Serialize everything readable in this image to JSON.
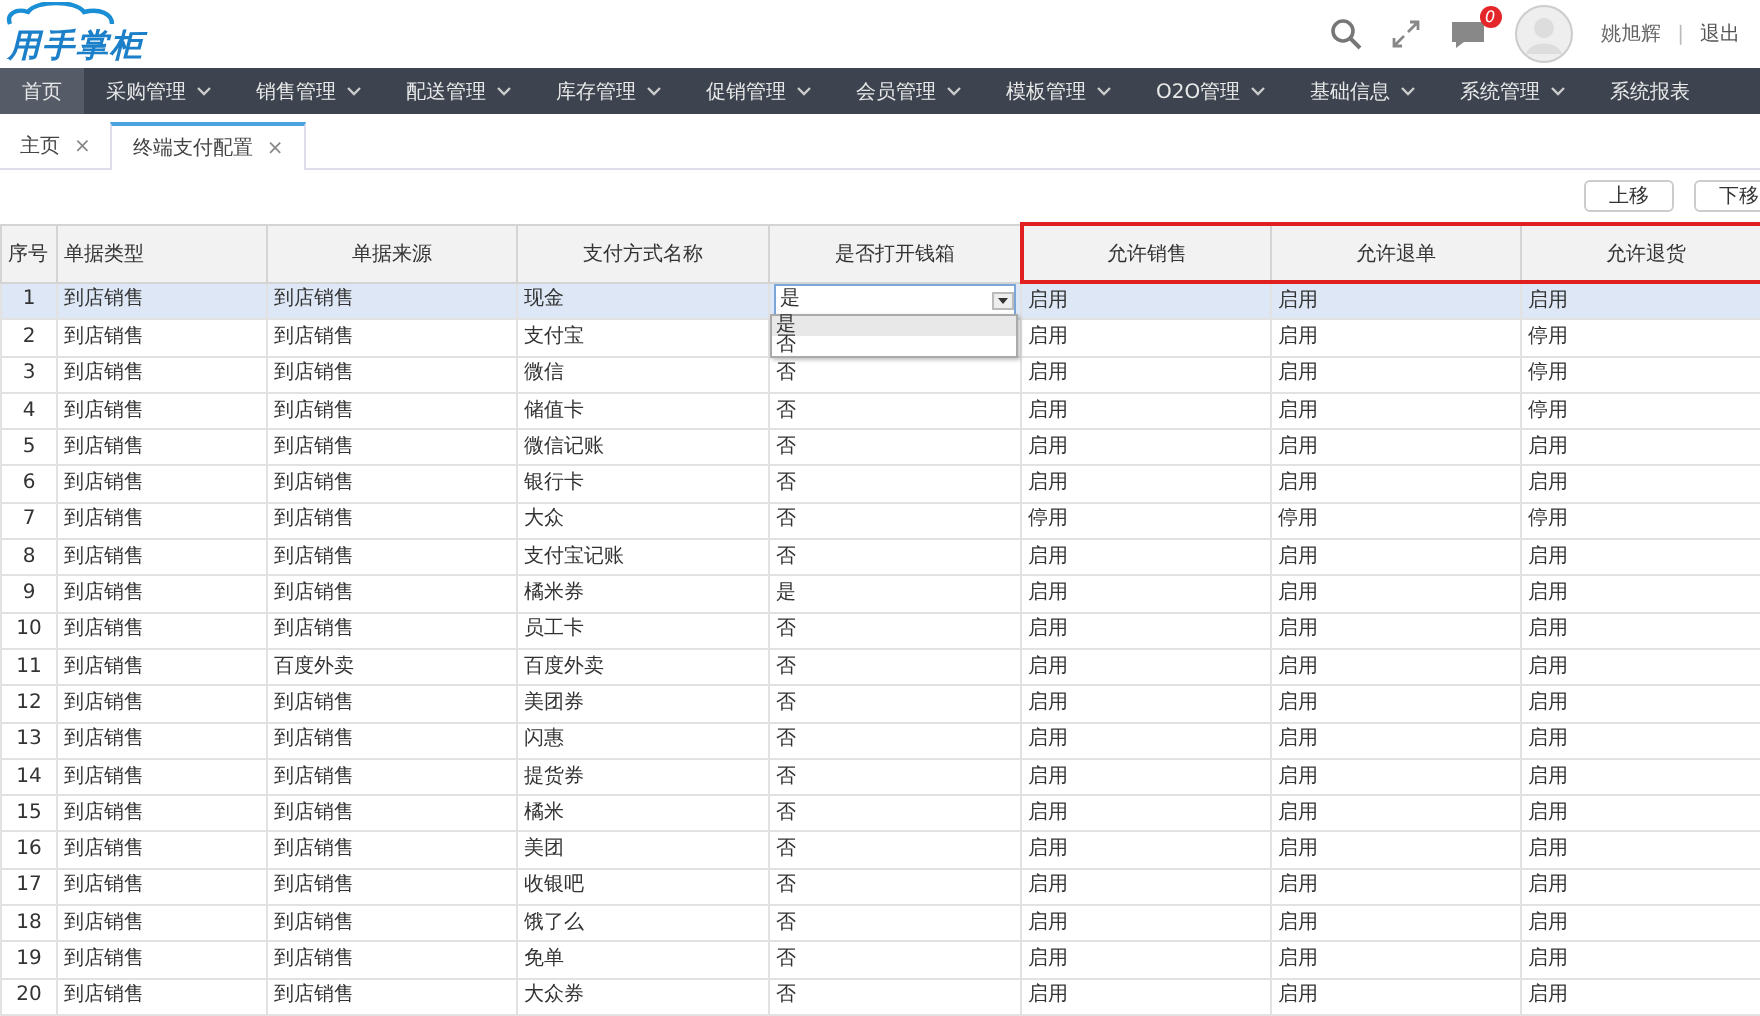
{
  "header": {
    "logo": "用手掌柜",
    "notification_count": "0",
    "user_name": "姚旭辉",
    "separator": "|",
    "logout": "退出"
  },
  "nav": [
    {
      "label": "首页",
      "selected": true,
      "dropdown": false
    },
    {
      "label": "采购管理",
      "selected": false,
      "dropdown": true
    },
    {
      "label": "销售管理",
      "selected": false,
      "dropdown": true
    },
    {
      "label": "配送管理",
      "selected": false,
      "dropdown": true
    },
    {
      "label": "库存管理",
      "selected": false,
      "dropdown": true
    },
    {
      "label": "促销管理",
      "selected": false,
      "dropdown": true
    },
    {
      "label": "会员管理",
      "selected": false,
      "dropdown": true
    },
    {
      "label": "模板管理",
      "selected": false,
      "dropdown": true
    },
    {
      "label": "O2O管理",
      "selected": false,
      "dropdown": true
    },
    {
      "label": "基础信息",
      "selected": false,
      "dropdown": true
    },
    {
      "label": "系统管理",
      "selected": false,
      "dropdown": true
    },
    {
      "label": "系统报表",
      "selected": false,
      "dropdown": false
    }
  ],
  "tabs": [
    {
      "label": "主页",
      "close": "×",
      "selected": false
    },
    {
      "label": "终端支付配置",
      "close": "×",
      "selected": true
    }
  ],
  "toolbar": {
    "buttons": [
      "上移",
      "下移"
    ]
  },
  "table": {
    "columns": [
      {
        "label": "序号",
        "highlighted": false
      },
      {
        "label": "单据类型",
        "highlighted": false
      },
      {
        "label": "单据来源",
        "highlighted": false
      },
      {
        "label": "支付方式名称",
        "highlighted": false
      },
      {
        "label": "是否打开钱箱",
        "highlighted": false
      },
      {
        "label": "允许销售",
        "highlighted": true
      },
      {
        "label": "允许退单",
        "highlighted": true
      },
      {
        "label": "允许退货",
        "highlighted": true
      }
    ],
    "rows": [
      {
        "no": "1",
        "type": "到店销售",
        "source": "到店销售",
        "payment": "现金",
        "cashbox": "是",
        "sale": "启用",
        "refund": "启用",
        "return_goods": "启用",
        "selected": true,
        "editing": true
      },
      {
        "no": "2",
        "type": "到店销售",
        "source": "到店销售",
        "payment": "支付宝",
        "sale": "启用",
        "refund": "启用",
        "return_goods": "停用",
        "selected": false,
        "editing": false
      },
      {
        "no": "3",
        "type": "到店销售",
        "source": "到店销售",
        "payment": "微信",
        "cashbox": "否",
        "sale": "启用",
        "refund": "启用",
        "return_goods": "停用",
        "selected": false,
        "editing": false
      },
      {
        "no": "4",
        "type": "到店销售",
        "source": "到店销售",
        "payment": "储值卡",
        "cashbox": "否",
        "sale": "启用",
        "refund": "启用",
        "return_goods": "停用",
        "selected": false,
        "editing": false
      },
      {
        "no": "5",
        "type": "到店销售",
        "source": "到店销售",
        "payment": "微信记账",
        "cashbox": "否",
        "sale": "启用",
        "refund": "启用",
        "return_goods": "启用",
        "selected": false,
        "editing": false
      },
      {
        "no": "6",
        "type": "到店销售",
        "source": "到店销售",
        "payment": "银行卡",
        "cashbox": "否",
        "sale": "启用",
        "refund": "启用",
        "return_goods": "启用",
        "selected": false,
        "editing": false
      },
      {
        "no": "7",
        "type": "到店销售",
        "source": "到店销售",
        "payment": "大众",
        "cashbox": "否",
        "sale": "停用",
        "refund": "停用",
        "return_goods": "停用",
        "selected": false,
        "editing": false
      },
      {
        "no": "8",
        "type": "到店销售",
        "source": "到店销售",
        "payment": "支付宝记账",
        "cashbox": "否",
        "sale": "启用",
        "refund": "启用",
        "return_goods": "启用",
        "selected": false,
        "editing": false
      },
      {
        "no": "9",
        "type": "到店销售",
        "source": "到店销售",
        "payment": "橘米券",
        "cashbox": "是",
        "sale": "启用",
        "refund": "启用",
        "return_goods": "启用",
        "selected": false,
        "editing": false
      },
      {
        "no": "10",
        "type": "到店销售",
        "source": "到店销售",
        "payment": "员工卡",
        "cashbox": "否",
        "sale": "启用",
        "refund": "启用",
        "return_goods": "启用",
        "selected": false,
        "editing": false
      },
      {
        "no": "11",
        "type": "到店销售",
        "source": "百度外卖",
        "payment": "百度外卖",
        "cashbox": "否",
        "sale": "启用",
        "refund": "启用",
        "return_goods": "启用",
        "selected": false,
        "editing": false
      },
      {
        "no": "12",
        "type": "到店销售",
        "source": "到店销售",
        "payment": "美团券",
        "cashbox": "否",
        "sale": "启用",
        "refund": "启用",
        "return_goods": "启用",
        "selected": false,
        "editing": false
      },
      {
        "no": "13",
        "type": "到店销售",
        "source": "到店销售",
        "payment": "闪惠",
        "cashbox": "否",
        "sale": "启用",
        "refund": "启用",
        "return_goods": "启用",
        "selected": false,
        "editing": false
      },
      {
        "no": "14",
        "type": "到店销售",
        "source": "到店销售",
        "payment": "提货券",
        "cashbox": "否",
        "sale": "启用",
        "refund": "启用",
        "return_goods": "启用",
        "selected": false,
        "editing": false
      },
      {
        "no": "15",
        "type": "到店销售",
        "source": "到店销售",
        "payment": "橘米",
        "cashbox": "否",
        "sale": "启用",
        "refund": "启用",
        "return_goods": "启用",
        "selected": false,
        "editing": false
      },
      {
        "no": "16",
        "type": "到店销售",
        "source": "到店销售",
        "payment": "美团",
        "cashbox": "否",
        "sale": "启用",
        "refund": "启用",
        "return_goods": "启用",
        "selected": false,
        "editing": false
      },
      {
        "no": "17",
        "type": "到店销售",
        "source": "到店销售",
        "payment": "收银吧",
        "cashbox": "否",
        "sale": "启用",
        "refund": "启用",
        "return_goods": "启用",
        "selected": false,
        "editing": false
      },
      {
        "no": "18",
        "type": "到店销售",
        "source": "到店销售",
        "payment": "饿了么",
        "cashbox": "否",
        "sale": "启用",
        "refund": "启用",
        "return_goods": "启用",
        "selected": false,
        "editing": false
      },
      {
        "no": "19",
        "type": "到店销售",
        "source": "到店销售",
        "payment": "免单",
        "cashbox": "否",
        "sale": "启用",
        "refund": "启用",
        "return_goods": "启用",
        "selected": false,
        "editing": false
      },
      {
        "no": "20",
        "type": "到店销售",
        "source": "到店销售",
        "payment": "大众券",
        "cashbox": "否",
        "sale": "启用",
        "refund": "启用",
        "return_goods": "启用",
        "selected": false,
        "editing": false
      }
    ]
  },
  "cashbox_dropdown": {
    "options": [
      {
        "label": "是",
        "selected": true
      },
      {
        "label": "否",
        "selected": false
      }
    ]
  }
}
